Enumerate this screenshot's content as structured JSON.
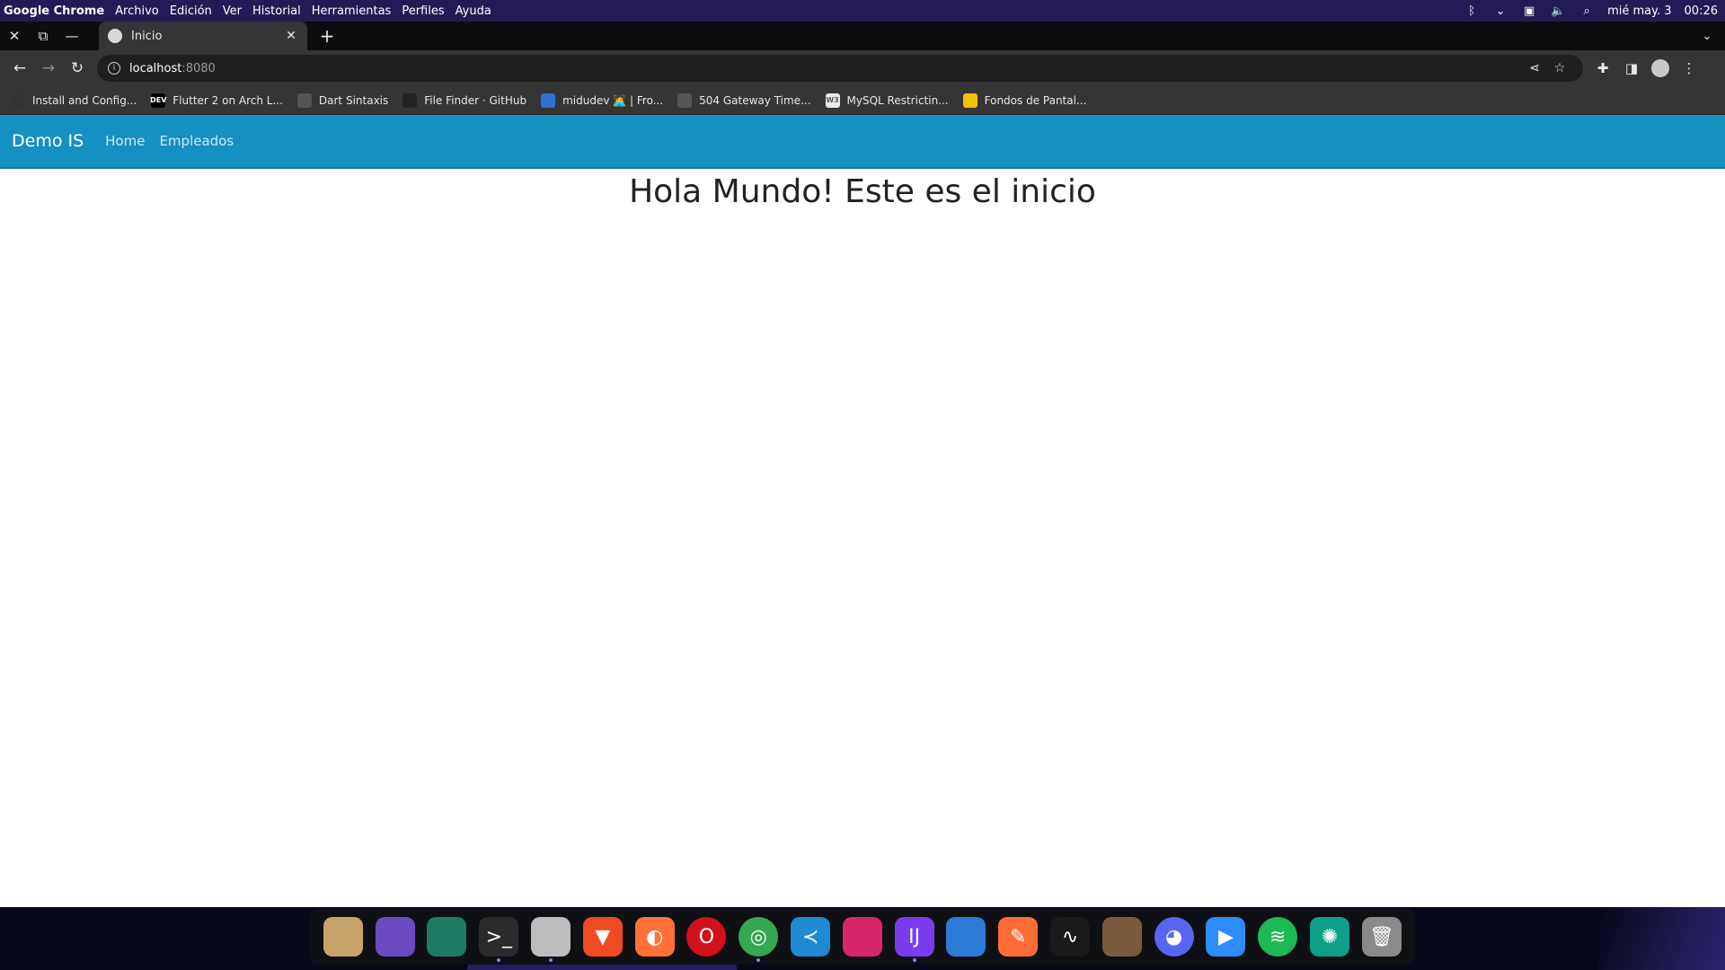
{
  "system_bar": {
    "app_name": "Google Chrome",
    "menus": [
      "Archivo",
      "Edición",
      "Ver",
      "Historial",
      "Herramientas",
      "Perfiles",
      "Ayuda"
    ],
    "date": "mié may. 3",
    "time": "00:26",
    "icons": [
      "bluetooth-icon",
      "chevron-down-icon",
      "network-icon",
      "volume-icon",
      "search-icon"
    ]
  },
  "tabs": {
    "active": {
      "title": "Inicio",
      "favicon": "globe-icon"
    },
    "new_tab_symbol": "+"
  },
  "toolbar": {
    "url_host": "localhost",
    "url_port": ":8080"
  },
  "bookmarks": [
    {
      "label": "Install and Config...",
      "color": "#333333",
      "glyph": ""
    },
    {
      "label": "Flutter 2 on Arch L...",
      "color": "#000000",
      "glyph": "DEV"
    },
    {
      "label": "Dart Sintaxis",
      "color": "#555555",
      "glyph": ""
    },
    {
      "label": "File Finder · GitHub",
      "color": "#222222",
      "glyph": ""
    },
    {
      "label": "midudev 🧑‍💻 | Fro...",
      "color": "#2f6fd6",
      "glyph": ""
    },
    {
      "label": "504 Gateway Time...",
      "color": "#555555",
      "glyph": ""
    },
    {
      "label": "MySQL Restrictin...",
      "color": "#e9e9e9",
      "glyph": "W3"
    },
    {
      "label": "Fondos de Pantal...",
      "color": "#f2c200",
      "glyph": ""
    }
  ],
  "page": {
    "brand": "Demo IS",
    "nav_links": [
      "Home",
      "Empleados"
    ],
    "heading": "Hola Mundo! Este es el inicio"
  },
  "dock": [
    {
      "name": "planet-app-icon",
      "color": "#c9a46a"
    },
    {
      "name": "bird-app-icon",
      "color": "#6a4bc2"
    },
    {
      "name": "hardware-app-icon",
      "color": "#1f7a63"
    },
    {
      "name": "terminal-app-icon",
      "color": "#2b2b2b"
    },
    {
      "name": "files-app-icon",
      "color": "#bdbdbd"
    },
    {
      "name": "brave-browser-icon",
      "color": "#f04a23"
    },
    {
      "name": "firefox-browser-icon",
      "color": "#ff7139"
    },
    {
      "name": "opera-browser-icon",
      "color": "#d3111a"
    },
    {
      "name": "chrome-browser-icon",
      "color": "#34a853"
    },
    {
      "name": "vscode-app-icon",
      "color": "#1f8ad2"
    },
    {
      "name": "netbeans-app-icon",
      "color": "#d8266a"
    },
    {
      "name": "intellij-app-icon",
      "color": "#7b3cf0"
    },
    {
      "name": "android-studio-icon",
      "color": "#2c7bd6"
    },
    {
      "name": "postman-app-icon",
      "color": "#ff6c37"
    },
    {
      "name": "system-monitor-icon",
      "color": "#1a1a1a"
    },
    {
      "name": "minecraft-app-icon",
      "color": "#7a5a3a"
    },
    {
      "name": "discord-app-icon",
      "color": "#5865f2"
    },
    {
      "name": "zoom-app-icon",
      "color": "#2d8cff"
    },
    {
      "name": "spotify-app-icon",
      "color": "#1db954"
    },
    {
      "name": "aperture-app-icon",
      "color": "#0f9f86"
    },
    {
      "name": "trash-icon",
      "color": "#8a8a8a"
    }
  ]
}
